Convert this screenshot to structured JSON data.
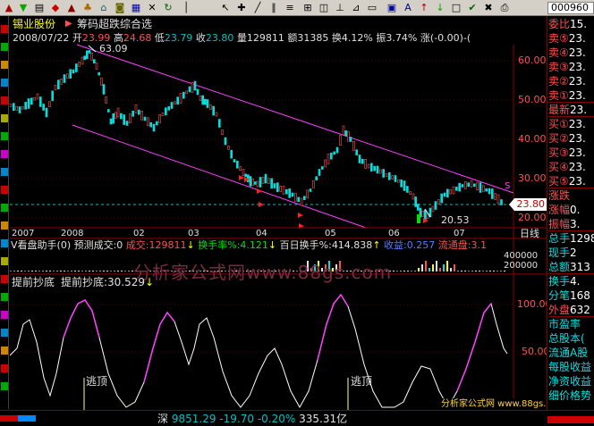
{
  "toolbar": {
    "code": "000960",
    "icons": [
      "arrow-up-icon",
      "arrow-down-icon",
      "document-icon",
      "chart-icon",
      "tri-icon",
      "bell-icon",
      "home-icon",
      "lock-icon",
      "grid-icon",
      "cross-icon",
      "refresh-icon",
      "cursor-icon",
      "magnifier-icon",
      "chart-line-icon",
      "measure-icon",
      "text-icon",
      "flag-icon",
      "folder-icon",
      "settings-icon",
      "table-icon",
      "pen-icon",
      "heart-icon",
      "help-icon",
      "list-icon",
      "monitor-icon"
    ]
  },
  "header": {
    "stock": "锡业股份",
    "indicator": "筹码超跌综合选"
  },
  "quote": {
    "date": "2008/07/22",
    "open_label": "开",
    "open": "23.99",
    "high_label": "高",
    "high": "24.68",
    "low_label": "低",
    "low": "23.79",
    "close_label": "收",
    "close": "23.80",
    "vol_label": "量",
    "vol": "129811",
    "amt_label": "额",
    "amt": "31385",
    "turn_label": "换",
    "turn": "4.12%",
    "amp_label": "振",
    "amp": "3.74%",
    "chg_label": "涨",
    "chg": "(-0.00)-("
  },
  "price_axis": [
    "60.00",
    "50.00",
    "40.00",
    "30.00",
    "20.00"
  ],
  "price_marks": {
    "high": "63.09",
    "low": "20.53",
    "cur": "23.80",
    "s_marker": "S"
  },
  "time_axis": [
    "2007",
    "2008",
    "02",
    "03",
    "04",
    "05",
    "06",
    "07"
  ],
  "period": "日线",
  "vol_panel": {
    "label": "V看盘助手(0)  预测成交:0",
    "vol_label": "成交:",
    "vol": "129811",
    "turn_label": "换手率%:",
    "turn": "4.121",
    "hundred_label": "百日换手%:",
    "hundred": "414.838",
    "profit_label": "收益:",
    "profit": "0.257",
    "float_label": "流通盘:",
    "float_val": "3.1",
    "axis": [
      "400000",
      "200000"
    ]
  },
  "osc_panel": {
    "name": "提前抄底",
    "title_label": "提前抄底:",
    "value": "30.529",
    "axis": [
      "100.00",
      "50.00"
    ],
    "signal": "逃顶"
  },
  "watermark": "分析家公式网www.88gs.com",
  "watermark2": "分析家公式网 www.88gs.com",
  "side": [
    {
      "label": "委比",
      "val": "15."
    },
    {
      "label": "卖⑤",
      "val": "23."
    },
    {
      "label": "卖④",
      "val": "23."
    },
    {
      "label": "卖③",
      "val": "23."
    },
    {
      "label": "卖②",
      "val": "23."
    },
    {
      "label": "卖①",
      "val": "23."
    },
    {
      "label": "最新",
      "val": "23."
    },
    {
      "label": "买①",
      "val": "23."
    },
    {
      "label": "买②",
      "val": "23."
    },
    {
      "label": "买③",
      "val": "23."
    },
    {
      "label": "买④",
      "val": "23."
    },
    {
      "label": "买⑤",
      "val": "23."
    },
    {
      "label": "涨跌",
      "val": ""
    },
    {
      "label": "涨幅",
      "val": "0."
    },
    {
      "label": "振幅",
      "val": "3."
    },
    {
      "label": "总手",
      "val": "1298"
    },
    {
      "label": "现手",
      "val": "2"
    },
    {
      "label": "总额",
      "val": "313"
    },
    {
      "label": "换手",
      "val": "4."
    },
    {
      "label": "分笔",
      "val": "168"
    },
    {
      "label": "外盘",
      "val": "632"
    },
    {
      "label": "市盈率",
      "val": ""
    },
    {
      "label": "总股本(",
      "val": ""
    },
    {
      "label": "流通A股",
      "val": ""
    },
    {
      "label": "每股收益",
      "val": ""
    },
    {
      "label": "净资收益",
      "val": ""
    },
    {
      "label": "细价格势",
      "val": ""
    }
  ],
  "status": {
    "market": "深",
    "index": "9851.29",
    "chg": "-19.70",
    "pct": "-0.20%",
    "amount": "335.31亿"
  },
  "colors": {
    "up": "#ff5050",
    "down": "#00e0e0",
    "ma": "#ff40ff",
    "yellow": "#ffff00"
  }
}
